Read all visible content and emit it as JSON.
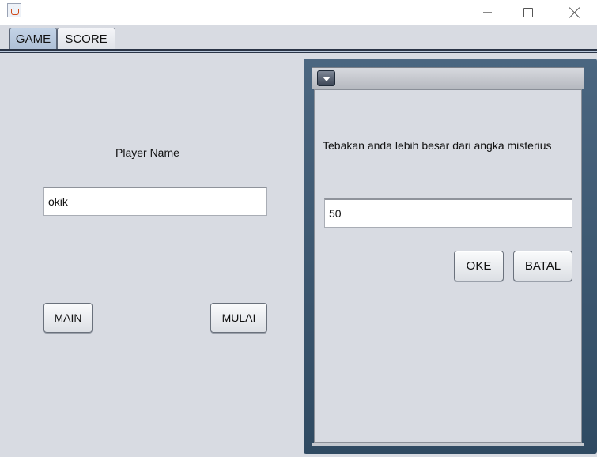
{
  "window": {
    "icon": "java-cup-icon",
    "controls": [
      "minimize-icon",
      "maximize-icon",
      "close-icon"
    ]
  },
  "tabs": [
    {
      "label": "GAME",
      "selected": true
    },
    {
      "label": "SCORE",
      "selected": false
    }
  ],
  "game": {
    "player_label": "Player Name",
    "player_value": "okik",
    "main_label": "MAIN",
    "mulai_label": "MULAI"
  },
  "dialog": {
    "menu_icon": "chevron-down-icon",
    "message": "Tebakan anda lebih besar dari angka misterius",
    "guess_value": "50",
    "ok_label": "OKE",
    "cancel_label": "BATAL"
  },
  "colors": {
    "selected_tab": "#b3c4da",
    "frame_border": "#3a556e"
  }
}
